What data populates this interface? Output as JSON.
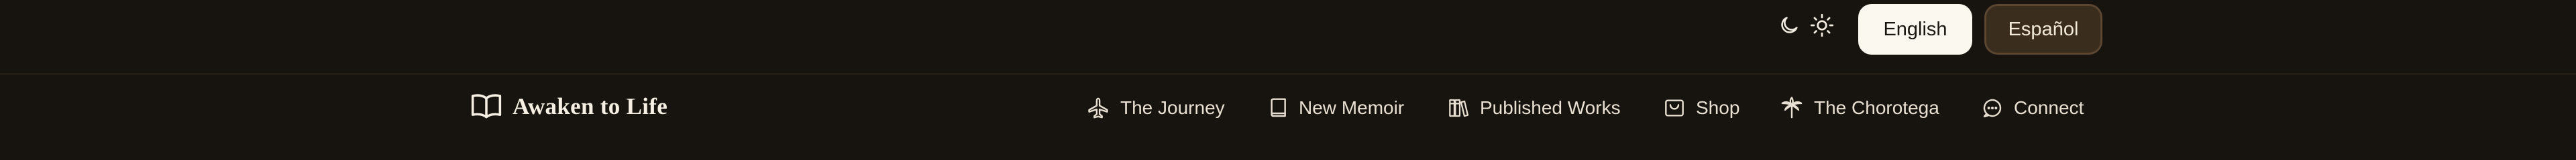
{
  "topbar": {
    "theme_icons": [
      "moon-icon",
      "sun-icon"
    ],
    "languages": [
      {
        "label": "English",
        "active": true
      },
      {
        "label": "Español",
        "active": false
      }
    ]
  },
  "brand": {
    "name": "Awaken to Life",
    "icon": "open-book-icon"
  },
  "nav": {
    "items": [
      {
        "label": "The Journey",
        "icon": "airplane-icon"
      },
      {
        "label": "New Memoir",
        "icon": "book-icon"
      },
      {
        "label": "Published Works",
        "icon": "books-icon"
      },
      {
        "label": "Shop",
        "icon": "shop-icon"
      },
      {
        "label": "The Chorotega",
        "icon": "palm-tree-icon"
      },
      {
        "label": "Connect",
        "icon": "chat-bubble-icon"
      }
    ]
  },
  "colors": {
    "background": "#17130e",
    "active_lang_bg": "#fbf8ef",
    "inactive_lang_bg": "#3a2d1e",
    "text": "#e8e0d2"
  }
}
